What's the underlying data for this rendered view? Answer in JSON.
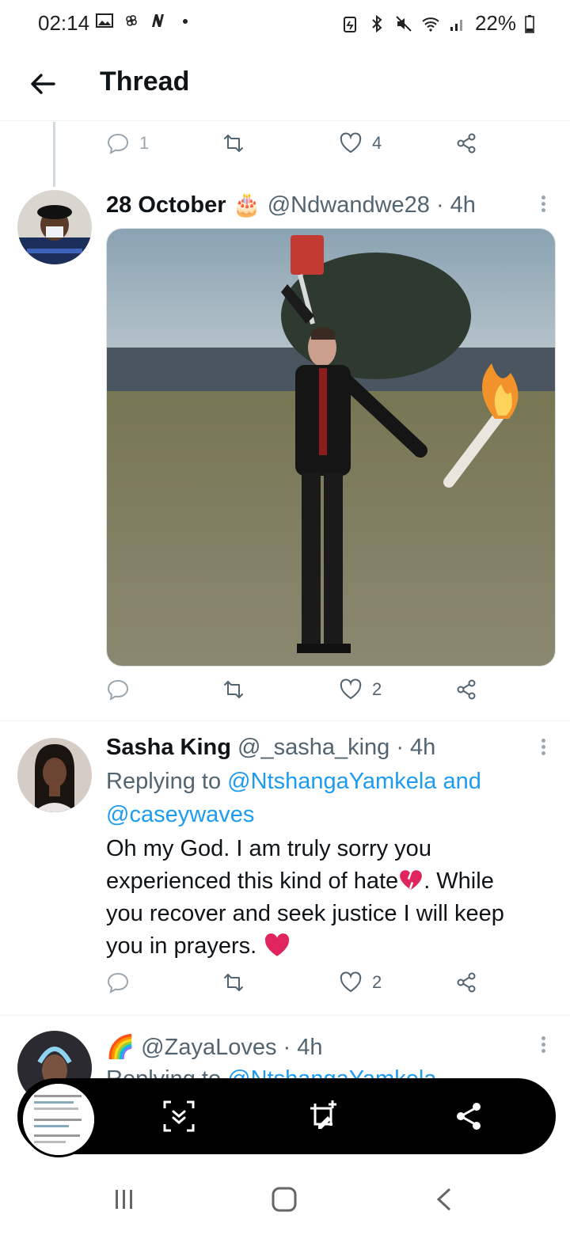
{
  "status_bar": {
    "time": "02:14",
    "battery": "22%"
  },
  "app_bar": {
    "title": "Thread"
  },
  "top_actions": {
    "reply_count": "1",
    "like_count": "4"
  },
  "tweets": [
    {
      "name": "28 October",
      "emoji": "🎂",
      "handle": "@Ndwandwe28",
      "time": "· 4h",
      "like_count": "2",
      "has_media": true
    },
    {
      "name": "Sasha King",
      "handle": "@_sasha_king",
      "time": "· 4h",
      "replying_prefix": "Replying to",
      "mentions": "@NtshangaYamkela and",
      "mentions2": "@caseywaves",
      "text_line1": "Oh my God. I am truly sorry you",
      "text_line2": "experienced this kind of hate",
      "text_line2b": ". While",
      "text_line3": "you recover and seek justice I will keep",
      "text_line4": "you in prayers.",
      "like_count": "2"
    },
    {
      "emoji": "🌈",
      "handle": "@ZayaLoves",
      "time": "· 4h",
      "replying_prefix": "Replying to",
      "mentions": "@NtshangaYamkela"
    }
  ],
  "colors": {
    "accent": "#1d9bf0",
    "muted": "#536471",
    "heart": "#e0245e"
  }
}
